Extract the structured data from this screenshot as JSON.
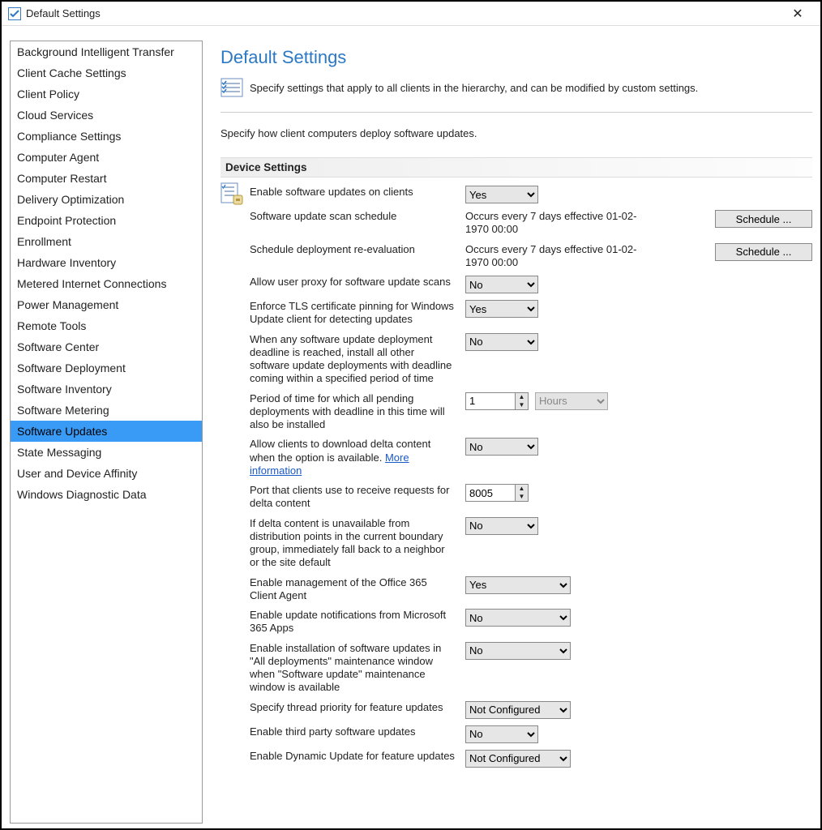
{
  "window": {
    "title": "Default Settings"
  },
  "sidebar": {
    "items": [
      {
        "label": "Background Intelligent Transfer",
        "selected": false
      },
      {
        "label": "Client Cache Settings",
        "selected": false
      },
      {
        "label": "Client Policy",
        "selected": false
      },
      {
        "label": "Cloud Services",
        "selected": false
      },
      {
        "label": "Compliance Settings",
        "selected": false
      },
      {
        "label": "Computer Agent",
        "selected": false
      },
      {
        "label": "Computer Restart",
        "selected": false
      },
      {
        "label": "Delivery Optimization",
        "selected": false
      },
      {
        "label": "Endpoint Protection",
        "selected": false
      },
      {
        "label": "Enrollment",
        "selected": false
      },
      {
        "label": "Hardware Inventory",
        "selected": false
      },
      {
        "label": "Metered Internet Connections",
        "selected": false
      },
      {
        "label": "Power Management",
        "selected": false
      },
      {
        "label": "Remote Tools",
        "selected": false
      },
      {
        "label": "Software Center",
        "selected": false
      },
      {
        "label": "Software Deployment",
        "selected": false
      },
      {
        "label": "Software Inventory",
        "selected": false
      },
      {
        "label": "Software Metering",
        "selected": false
      },
      {
        "label": "Software Updates",
        "selected": true
      },
      {
        "label": "State Messaging",
        "selected": false
      },
      {
        "label": "User and Device Affinity",
        "selected": false
      },
      {
        "label": "Windows Diagnostic Data",
        "selected": false
      }
    ]
  },
  "main": {
    "heading": "Default Settings",
    "description": "Specify settings that apply to all clients in the hierarchy, and can be modified by custom settings.",
    "sub_description": "Specify how client computers deploy software updates.",
    "section_title": "Device Settings",
    "more_info_link": "More information",
    "schedule_btn": "Schedule ...",
    "rows": {
      "enable_updates": {
        "label": "Enable software updates on clients",
        "value": "Yes"
      },
      "scan_schedule": {
        "label": "Software update scan schedule",
        "value": "Occurs every 7 days effective 01-02-1970 00:00"
      },
      "reeval_schedule": {
        "label": "Schedule deployment re-evaluation",
        "value": "Occurs every 7 days effective 01-02-1970 00:00"
      },
      "user_proxy": {
        "label": "Allow user proxy for software update scans",
        "value": "No"
      },
      "tls_pinning": {
        "label": "Enforce TLS certificate pinning for Windows Update client for detecting updates",
        "value": "Yes"
      },
      "deadline_install": {
        "label": "When any software update deployment deadline is reached, install all other software update deployments with deadline coming within a specified period of time",
        "value": "No"
      },
      "deadline_period": {
        "label": "Period of time for which all pending deployments with deadline in this time will also be installed",
        "value": "1",
        "unit": "Hours"
      },
      "delta_download": {
        "label": "Allow clients to download delta content when the option is available.",
        "value": "No"
      },
      "delta_port": {
        "label": "Port that clients use to receive requests for delta content",
        "value": "8005"
      },
      "fallback": {
        "label": "If delta content is unavailable from distribution points in the current boundary group, immediately fall back to a neighbor or the site default",
        "value": "No"
      },
      "o365_agent": {
        "label": "Enable management of the Office 365 Client Agent",
        "value": "Yes"
      },
      "m365_notify": {
        "label": "Enable update notifications from Microsoft 365 Apps",
        "value": "No"
      },
      "maint_window": {
        "label": "Enable installation of software updates in \"All deployments\" maintenance window when \"Software update\" maintenance window is available",
        "value": "No"
      },
      "thread_priority": {
        "label": "Specify thread priority for feature updates",
        "value": "Not Configured"
      },
      "third_party": {
        "label": "Enable third party software updates",
        "value": "No"
      },
      "dynamic_update": {
        "label": "Enable Dynamic Update for feature updates",
        "value": "Not Configured"
      }
    }
  }
}
